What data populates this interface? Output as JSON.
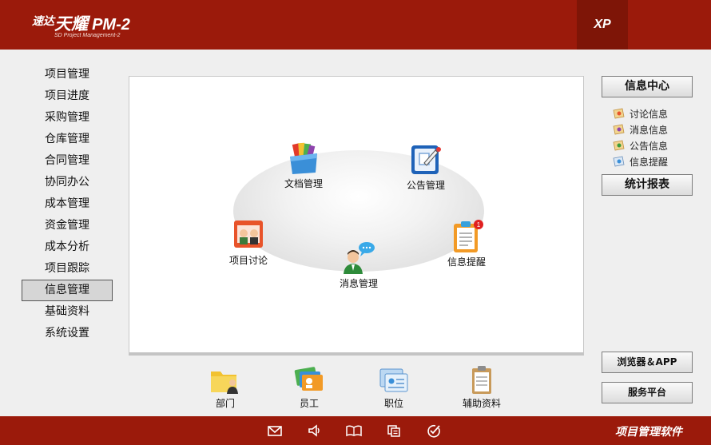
{
  "header": {
    "logo_small": "速达",
    "logo_big": "天耀",
    "logo_pm": "PM-2",
    "logo_sub": "SD Project Management-2",
    "xp_label": "XP"
  },
  "sidebar": {
    "items": [
      {
        "label": "项目管理"
      },
      {
        "label": "项目进度"
      },
      {
        "label": "采购管理"
      },
      {
        "label": "仓库管理"
      },
      {
        "label": "合同管理"
      },
      {
        "label": "协同办公"
      },
      {
        "label": "成本管理"
      },
      {
        "label": "资金管理"
      },
      {
        "label": "成本分析"
      },
      {
        "label": "项目跟踪"
      },
      {
        "label": "信息管理"
      },
      {
        "label": "基础资料"
      },
      {
        "label": "系统设置"
      }
    ],
    "active_index": 10
  },
  "main": {
    "modules": [
      {
        "label": "文档管理",
        "icon": "document-folder-icon"
      },
      {
        "label": "公告管理",
        "icon": "notice-board-icon"
      },
      {
        "label": "项目讨论",
        "icon": "project-discussion-icon"
      },
      {
        "label": "消息管理",
        "icon": "message-user-icon"
      },
      {
        "label": "信息提醒",
        "icon": "clipboard-reminder-icon",
        "badge": "1"
      }
    ]
  },
  "quick": {
    "items": [
      {
        "label": "部门",
        "icon": "department-folder-icon"
      },
      {
        "label": "员工",
        "icon": "employee-cards-icon"
      },
      {
        "label": "职位",
        "icon": "position-card-icon"
      },
      {
        "label": "辅助资料",
        "icon": "auxiliary-clipboard-icon"
      }
    ]
  },
  "right": {
    "info_center": "信息中心",
    "info_items": [
      {
        "label": "讨论信息"
      },
      {
        "label": "消息信息"
      },
      {
        "label": "公告信息"
      },
      {
        "label": "信息提醒"
      }
    ],
    "stats_report": "统计报表",
    "browser_app": "浏览器＆APP",
    "service_platform": "服务平台"
  },
  "footer": {
    "text": "项目管理软件",
    "icons": [
      "mail-icon",
      "speaker-icon",
      "book-icon",
      "copy-icon",
      "check-circle-icon"
    ]
  },
  "colors": {
    "brand_red": "#9b1a0b",
    "xp_dark_red": "#7e1507",
    "background": "#efefef"
  }
}
